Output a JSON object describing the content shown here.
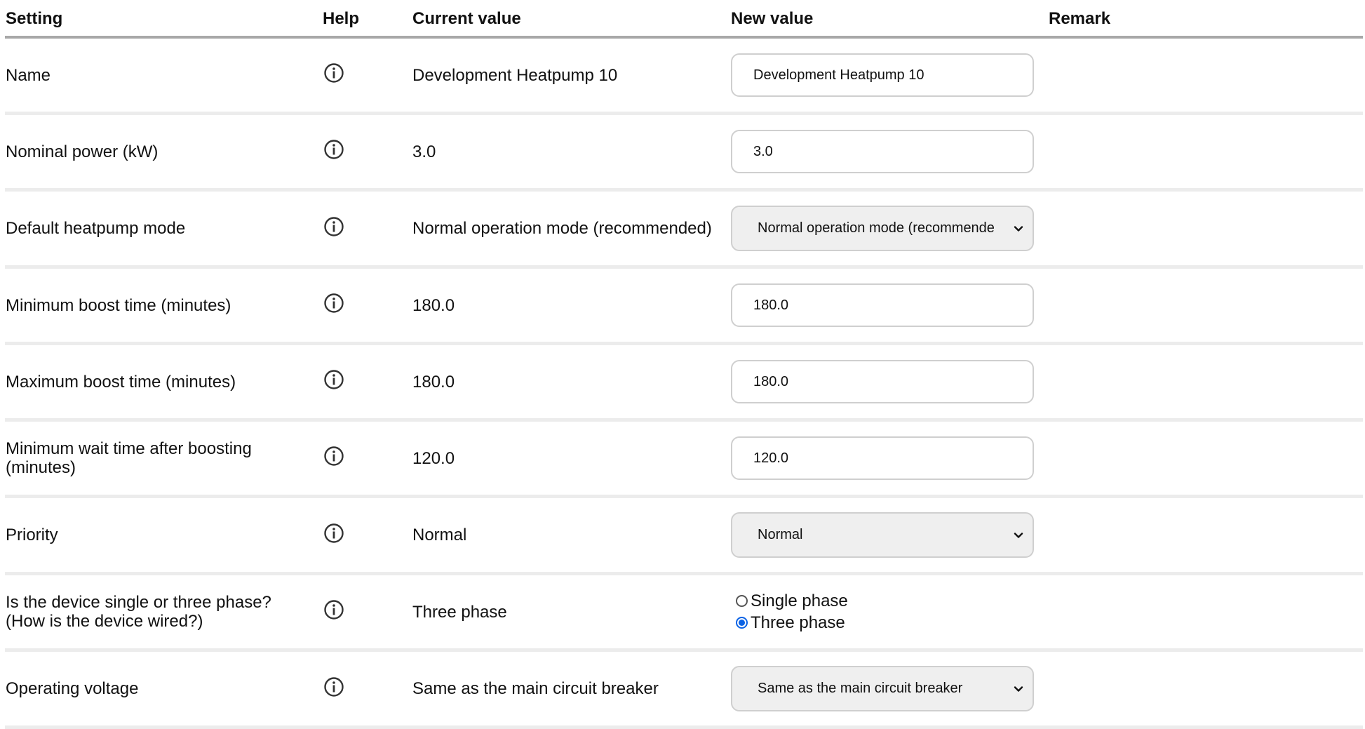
{
  "headers": {
    "setting": "Setting",
    "help": "Help",
    "current": "Current value",
    "new": "New value",
    "remark": "Remark"
  },
  "rows": [
    {
      "setting": "Name",
      "current": "Development Heatpump 10",
      "input_value": "Development Heatpump 10",
      "control": "text",
      "help_icon": "info-icon"
    },
    {
      "setting": "Nominal power (kW)",
      "current": "3.0",
      "input_value": "3.0",
      "control": "text",
      "help_icon": "info-icon"
    },
    {
      "setting": "Default heatpump mode",
      "current": "Normal operation mode (recommended)",
      "select_value": "Normal operation mode (recommende",
      "control": "select",
      "help_icon": "info-icon"
    },
    {
      "setting": "Minimum boost time (minutes)",
      "current": "180.0",
      "input_value": "180.0",
      "control": "text",
      "help_icon": "info-icon"
    },
    {
      "setting": "Maximum boost time (minutes)",
      "current": "180.0",
      "input_value": "180.0",
      "control": "text",
      "help_icon": "info-icon"
    },
    {
      "setting_line1": "Minimum wait time after boosting",
      "setting_line2": "(minutes)",
      "current": "120.0",
      "input_value": "120.0",
      "control": "text",
      "help_icon": "info-icon"
    },
    {
      "setting": "Priority",
      "current": "Normal",
      "select_value": "Normal",
      "control": "select",
      "help_icon": "info-icon"
    },
    {
      "setting_line1": "Is the device single or three phase?",
      "setting_line2": "(How is the device wired?)",
      "current": "Three phase",
      "control": "radio",
      "options": [
        {
          "label": "Single phase",
          "checked": false
        },
        {
          "label": "Three phase",
          "checked": true
        }
      ],
      "help_icon": "info-icon"
    },
    {
      "setting": "Operating voltage",
      "current": "Same as the main circuit breaker",
      "select_value": "Same as the main circuit breaker",
      "control": "select",
      "help_icon": "info-icon"
    }
  ],
  "colors": {
    "header_rule": "#a8a8a8",
    "row_rule": "#ececec",
    "radio_checked": "#0b63e5",
    "select_bg": "#efefef"
  }
}
